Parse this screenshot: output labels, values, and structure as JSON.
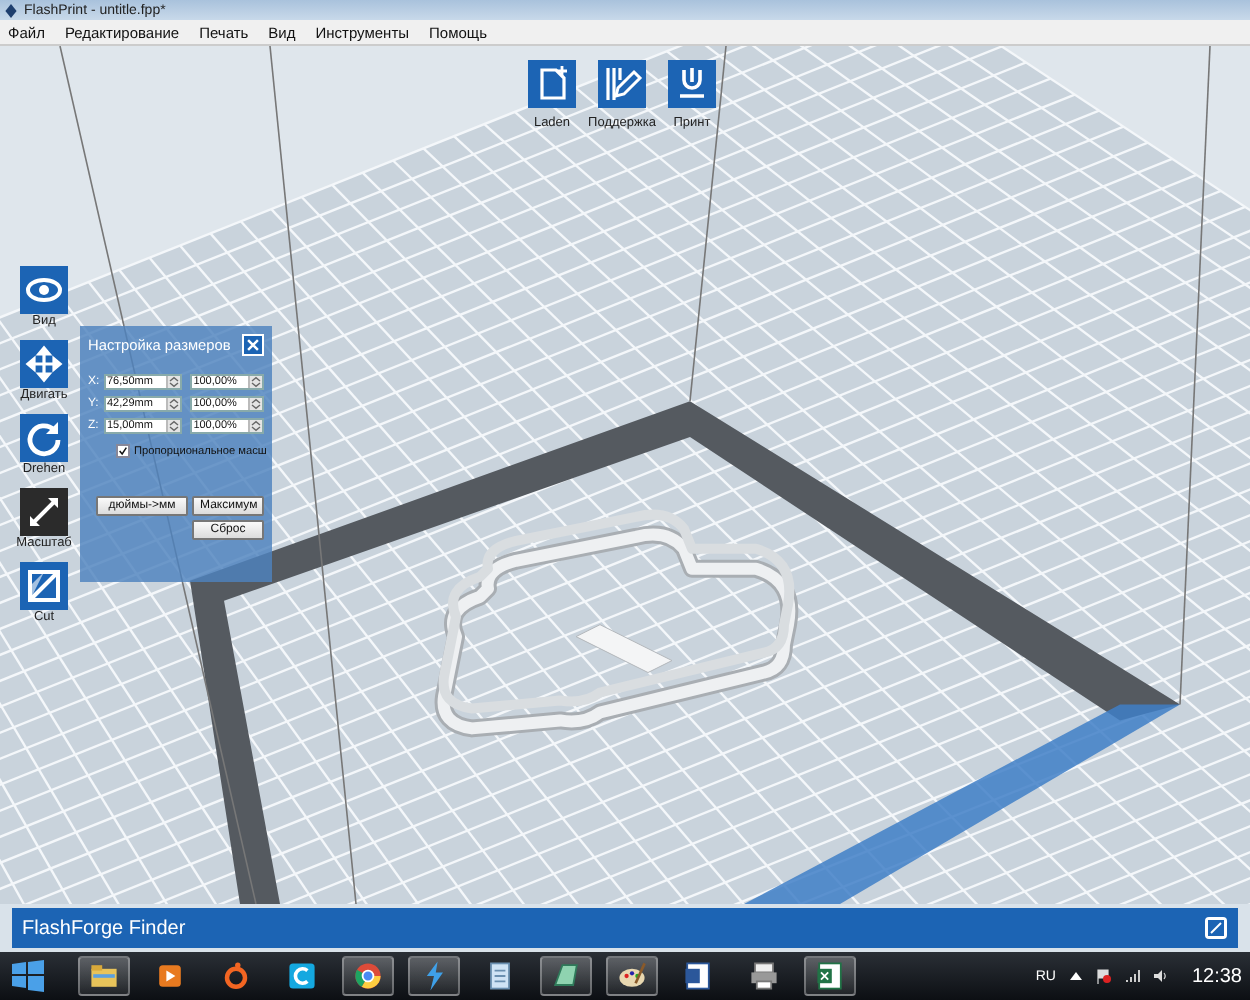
{
  "window": {
    "title": "FlashPrint - untitle.fpp*"
  },
  "menu": [
    "Файл",
    "Редактирование",
    "Печать",
    "Вид",
    "Инструменты",
    "Помощь"
  ],
  "top_toolbar": [
    {
      "label": "Laden",
      "kind": "load"
    },
    {
      "label": "Поддержка",
      "kind": "support"
    },
    {
      "label": "Принт",
      "kind": "print"
    }
  ],
  "side_toolbar": [
    {
      "label": "Вид",
      "kind": "view",
      "selected": false
    },
    {
      "label": "Двигать",
      "kind": "move",
      "selected": false
    },
    {
      "label": "Drehen",
      "kind": "rotate",
      "selected": false
    },
    {
      "label": "Масштаб",
      "kind": "scale",
      "selected": true
    },
    {
      "label": "Cut",
      "kind": "cut",
      "selected": false
    }
  ],
  "scale_dialog": {
    "title": "Настройка размеров",
    "rows": [
      {
        "axis": "X:",
        "size": "76,50mm",
        "percent": "100,00%"
      },
      {
        "axis": "Y:",
        "size": "42,29mm",
        "percent": "100,00%"
      },
      {
        "axis": "Z:",
        "size": "15,00mm",
        "percent": "100,00%"
      }
    ],
    "proportional": {
      "label": "Пропорциональное масш",
      "checked": true
    },
    "buttons": [
      "дюймы->мм",
      "Максимум",
      "Сброс"
    ]
  },
  "status_bar": {
    "text": "FlashForge Finder"
  },
  "taskbar": {
    "apps": [
      {
        "kind": "explorer",
        "running": true
      },
      {
        "kind": "media",
        "running": false
      },
      {
        "kind": "origin",
        "running": false
      },
      {
        "kind": "c-app",
        "running": false
      },
      {
        "kind": "chrome",
        "running": true
      },
      {
        "kind": "flashprint",
        "running": true
      },
      {
        "kind": "notepad",
        "running": false
      },
      {
        "kind": "glass",
        "running": true
      },
      {
        "kind": "paint",
        "running": true
      },
      {
        "kind": "word",
        "running": false
      },
      {
        "kind": "printer",
        "running": false
      },
      {
        "kind": "excel",
        "running": true
      }
    ],
    "language": "RU",
    "clock": "12:38"
  }
}
